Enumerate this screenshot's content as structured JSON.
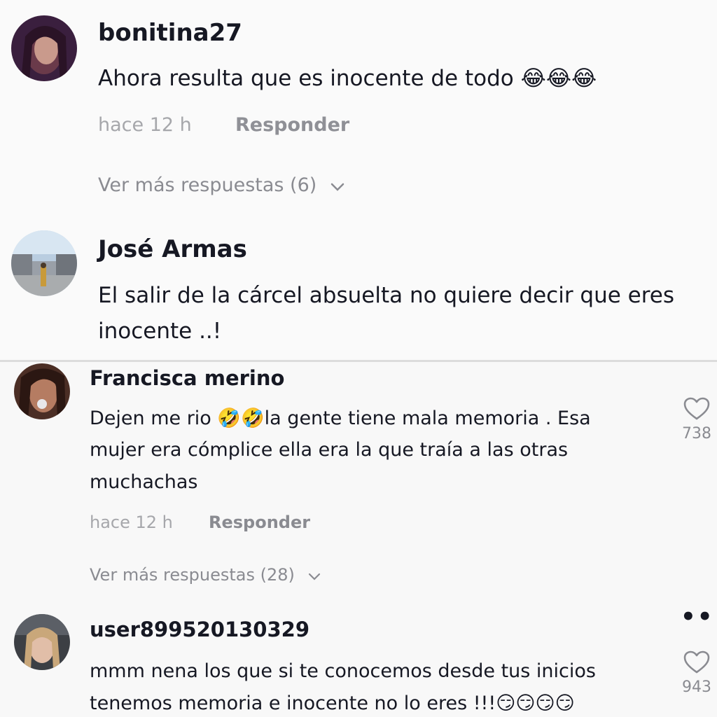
{
  "top_comments": [
    {
      "username": "bonitina27",
      "text": "Ahora resulta que es inocente de todo",
      "emoji": "😂😂😂",
      "time": "hace 12 h",
      "reply_label": "Responder",
      "more_replies": "Ver más respuestas (6)"
    },
    {
      "username": "José Armas",
      "text_line1": "El salir de la cárcel absuelta no quiere decir que eres",
      "text_line2": "inocente ..!"
    }
  ],
  "bottom_comments": [
    {
      "username": "Francisca merino",
      "line1_prefix": "Dejen me rio ",
      "line1_emoji": "🤣🤣",
      "line1_suffix": "la gente tiene mala memoria . Esa",
      "line2": "mujer era cómplice ella era la que traía a las otras",
      "line3": "muchachas",
      "time": "hace 12 h",
      "reply_label": "Responder",
      "more_replies": "Ver más respuestas (28)",
      "likes": "738",
      "like_icon": "heart-outline-icon"
    },
    {
      "username": "user899520130329",
      "line1": "mmm nena los que si te conocemos desde tus inicios",
      "line2_prefix": "tenemos memoria e inocente no lo eres !!!",
      "line2_emoji": "😏😏😏😏",
      "likes": "943",
      "like_icon": "heart-outline-icon",
      "menu_icon": "more-dots-icon"
    }
  ],
  "colors": {
    "text_primary": "#161823",
    "text_secondary": "#8a8b91",
    "background": "#fafafa"
  }
}
